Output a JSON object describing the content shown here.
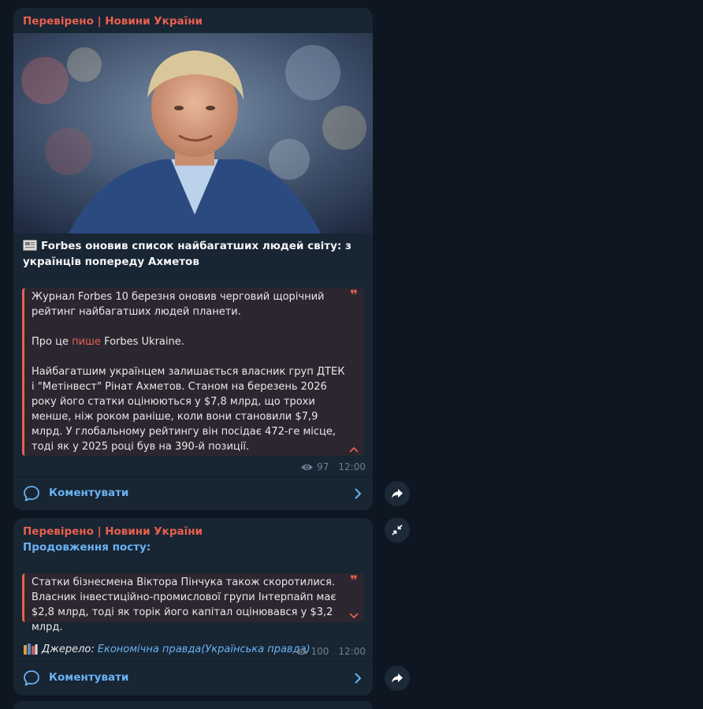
{
  "posts": [
    {
      "channel": "Перевірено | Новини України",
      "headline": "Forbes оновив список найбагатших людей світу: з українців попереду Ахметов",
      "quote": {
        "p1": "Журнал Forbes 10 березня оновив черговий щорічний рейтинг найбагатших людей планети.",
        "p2_before": "Про це ",
        "p2_link": "пише",
        "p2_after": " Forbes Ukraine.",
        "p3": "Найбагатшим українцем залишається власник груп ДТЕК і \"Метінвест\" Рінат Ахметов. Станом на березень 2026 року його статки оцінюються у $7,8 млрд, що трохи менше, ніж роком раніше, коли вони становили $7,9 млрд. У глобальному рейтингу він посідає 472-ге місце, тоді як у 2025 році був на 390-й позиції.",
        "mark": "❞"
      },
      "views": "97",
      "time": "12:00",
      "comment_label": "Коментувати"
    },
    {
      "channel": "Перевірено | Новини України",
      "continuation": "Продовження посту:",
      "quote": {
        "p1": "Статки бізнесмена Віктора Пінчука також скоротилися. Власник інвестиційно-промислової групи Інтерпайп має $2,8 млрд, тоді як торік його капітал оцінювався у $3,2 млрд.",
        "mark": "❞"
      },
      "source_label": "Джерело:",
      "source_link": "Економічна правда(Українська правда)",
      "views": "100",
      "time": "12:00",
      "comment_label": "Коментувати"
    }
  ],
  "colors": {
    "background": "#0e1621",
    "bubble": "#182533",
    "accent_red": "#e8604f",
    "link_blue": "#6ab2f2",
    "meta_gray": "#6d7f8f"
  },
  "icons": {
    "views": "eye-icon",
    "comment": "comment-bubble-icon",
    "chevron": "chevron-right-icon",
    "share": "share-arrow-icon",
    "collapse": "collapse-arrows-icon",
    "quote_expand_up": "chevron-up-icon",
    "quote_expand_down": "chevron-down-icon"
  }
}
